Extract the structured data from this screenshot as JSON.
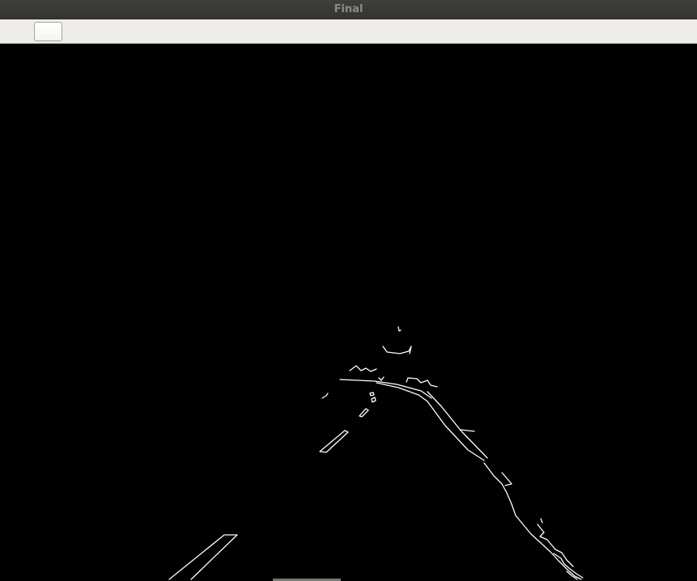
{
  "window": {
    "title": "Final"
  },
  "toolbar": {
    "button_label": ""
  },
  "colors": {
    "titlebar": "#3c3b37",
    "title_text": "#8c8a85",
    "toolbar": "#efedea",
    "canvas": "#000000",
    "edges": "#ffffff"
  }
}
